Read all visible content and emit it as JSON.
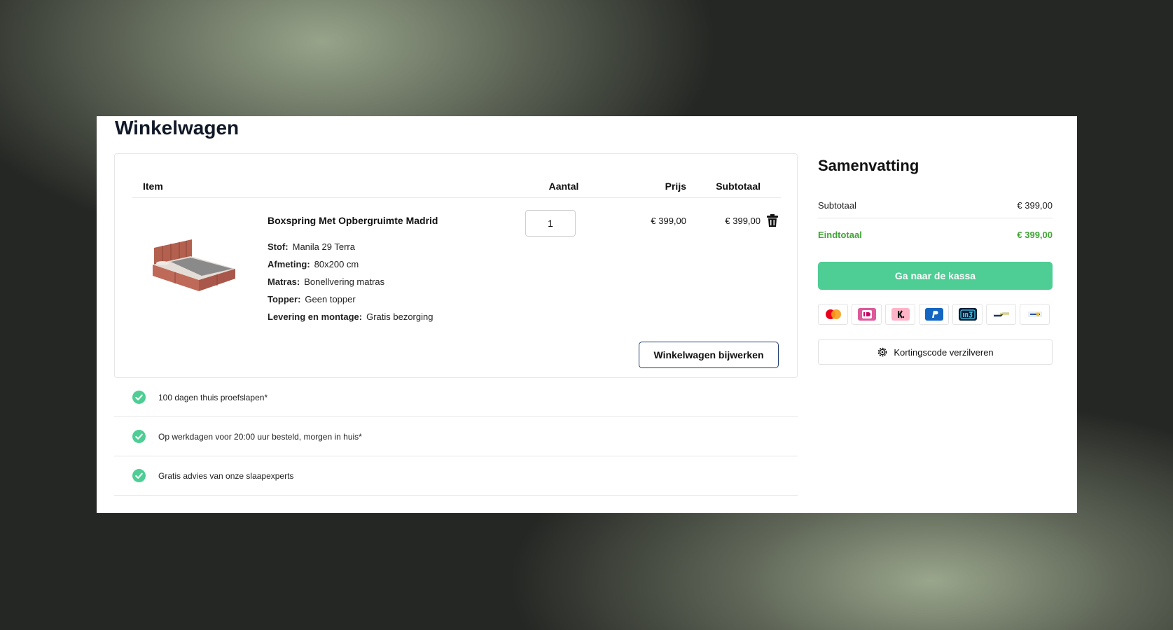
{
  "page": {
    "title": "Winkelwagen"
  },
  "cart": {
    "columns": {
      "item": "Item",
      "quantity": "Aantal",
      "price": "Prijs",
      "subtotal": "Subtotaal"
    },
    "item": {
      "name": "Boxspring Met Opbergruimte Madrid",
      "attributes": [
        {
          "label": "Stof:",
          "value": "Manila 29 Terra"
        },
        {
          "label": "Afmeting:",
          "value": "80x200 cm"
        },
        {
          "label": "Matras:",
          "value": "Bonellvering matras"
        },
        {
          "label": "Topper:",
          "value": "Geen topper"
        },
        {
          "label": "Levering en montage:",
          "value": "Gratis bezorging"
        }
      ],
      "quantity": "1",
      "price": "€ 399,00",
      "subtotal": "€ 399,00"
    },
    "update_label": "Winkelwagen bijwerken"
  },
  "usps": [
    "100 dagen thuis proefslapen*",
    "Op werkdagen voor 20:00 uur besteld, morgen in huis*",
    "Gratis advies van onze slaapexperts"
  ],
  "summary": {
    "title": "Samenvatting",
    "subtotal_label": "Subtotaal",
    "subtotal_value": "€ 399,00",
    "total_label": "Eindtotaal",
    "total_value": "€ 399,00",
    "checkout_label": "Ga naar de kassa",
    "payment_methods": [
      "mastercard-icon",
      "ideal-icon",
      "klarna-icon",
      "paypal-icon",
      "in3-icon",
      "bancontact-icon",
      "sepa-icon"
    ],
    "coupon_label": "Kortingscode verzilveren"
  },
  "colors": {
    "accent": "#4ecd94",
    "total": "#3fa535",
    "check": "#4ecd94",
    "outline": "#1f3d6e"
  }
}
